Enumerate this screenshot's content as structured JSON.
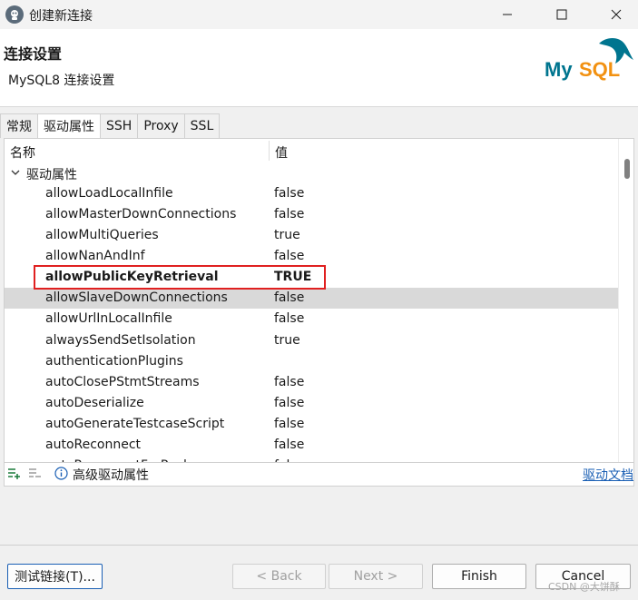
{
  "window": {
    "title": "创建新连接"
  },
  "header": {
    "title": "连接设置",
    "subtitle": "MySQL8 连接设置",
    "logo_text": "MySQL"
  },
  "tabs": [
    {
      "label": "常规",
      "active": false
    },
    {
      "label": "驱动属性",
      "active": true
    },
    {
      "label": "SSH",
      "active": false
    },
    {
      "label": "Proxy",
      "active": false
    },
    {
      "label": "SSL",
      "active": false
    }
  ],
  "properties": {
    "col_name": "名称",
    "col_value": "值",
    "group_label": "驱动属性",
    "rows": [
      {
        "name": "allowLoadLocalInfile",
        "value": "false"
      },
      {
        "name": "allowMasterDownConnections",
        "value": "false"
      },
      {
        "name": "allowMultiQueries",
        "value": "true"
      },
      {
        "name": "allowNanAndInf",
        "value": "false"
      },
      {
        "name": "allowPublicKeyRetrieval",
        "value": "TRUE"
      },
      {
        "name": "allowSlaveDownConnections",
        "value": "false"
      },
      {
        "name": "allowUrlInLocalInfile",
        "value": "false"
      },
      {
        "name": "alwaysSendSetIsolation",
        "value": "true"
      },
      {
        "name": "authenticationPlugins",
        "value": ""
      },
      {
        "name": "autoClosePStmtStreams",
        "value": "false"
      },
      {
        "name": "autoDeserialize",
        "value": "false"
      },
      {
        "name": "autoGenerateTestcaseScript",
        "value": "false"
      },
      {
        "name": "autoReconnect",
        "value": "false"
      },
      {
        "name": "autoReconnectForPools",
        "value": "false"
      }
    ]
  },
  "panel_footer": {
    "advanced_label": "高级驱动属性",
    "docs_link": "驱动文档"
  },
  "buttons": {
    "test": "测试链接(T)...",
    "back": "< Back",
    "next": "Next >",
    "finish": "Finish",
    "cancel": "Cancel"
  },
  "watermark": "CSDN @大饼酥",
  "colors": {
    "highlight_border": "#e02020",
    "selected_row": "#d9d9d9",
    "link": "#1a5fb4",
    "logo_blue": "#00758f",
    "logo_orange": "#f29111"
  }
}
